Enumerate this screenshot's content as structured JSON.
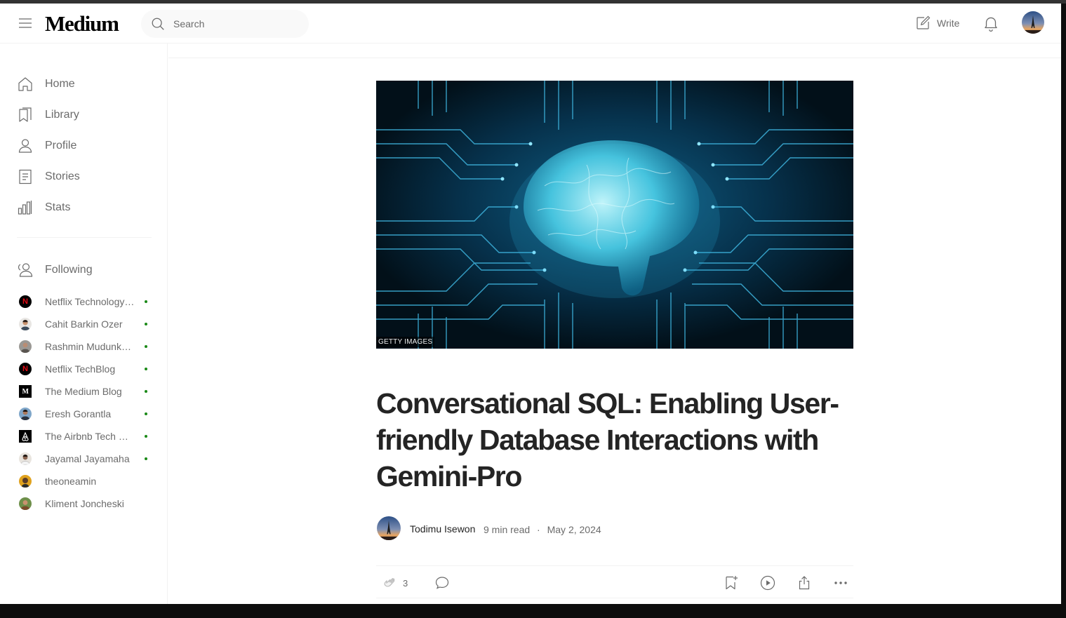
{
  "header": {
    "logo": "Medium",
    "search_placeholder": "Search",
    "write_label": "Write"
  },
  "sidebar": {
    "nav": [
      {
        "label": "Home",
        "icon": "home-icon"
      },
      {
        "label": "Library",
        "icon": "bookmarks-icon"
      },
      {
        "label": "Profile",
        "icon": "person-icon"
      },
      {
        "label": "Stories",
        "icon": "document-icon"
      },
      {
        "label": "Stats",
        "icon": "bar-chart-icon"
      }
    ],
    "following_label": "Following",
    "following": [
      {
        "name": "Netflix Technology Blog",
        "new": true
      },
      {
        "name": "Cahit Barkin Ozer",
        "new": true
      },
      {
        "name": "Rashmin Mudunkotuwa",
        "new": true
      },
      {
        "name": "Netflix TechBlog",
        "new": true
      },
      {
        "name": "The Medium Blog",
        "new": true
      },
      {
        "name": "Eresh Gorantla",
        "new": true
      },
      {
        "name": "The Airbnb Tech Blog",
        "new": true
      },
      {
        "name": "Jayamal Jayamaha",
        "new": true
      },
      {
        "name": "theoneamin",
        "new": false
      },
      {
        "name": "Kliment Joncheski",
        "new": false
      }
    ]
  },
  "article": {
    "image_caption": "GETTY IMAGES",
    "title": "Conversational SQL: Enabling User-friendly Database Interactions with Gemini-Pro",
    "author": "Todimu Isewon",
    "read_time": "9 min read",
    "separator": "·",
    "date": "May 2, 2024",
    "claps": "3"
  },
  "colors": {
    "accent_green": "#1a8917",
    "text": "#242424",
    "muted": "#6b6b6b"
  }
}
